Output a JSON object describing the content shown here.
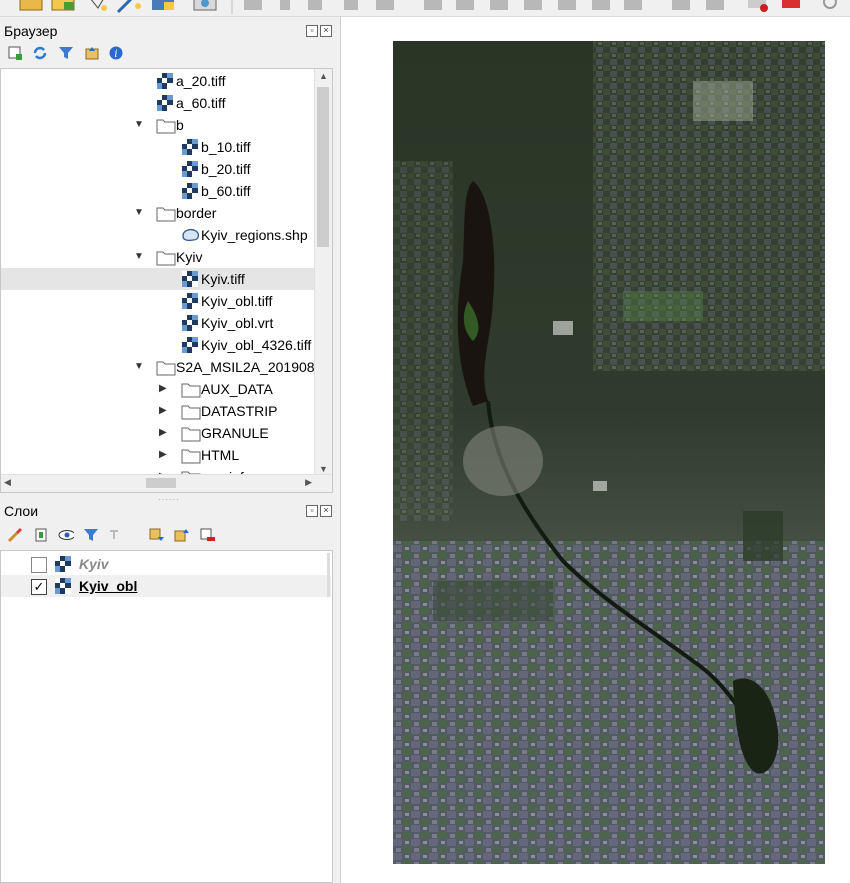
{
  "browser_panel": {
    "title": "Браузер",
    "tree": [
      {
        "label": "a_20.tiff",
        "icon": "raster-icon"
      },
      {
        "label": "a_60.tiff",
        "icon": "raster-icon"
      },
      {
        "label": "b",
        "icon": "folder-icon",
        "expanded": true
      },
      {
        "label": "b_10.tiff",
        "icon": "raster-icon"
      },
      {
        "label": "b_20.tiff",
        "icon": "raster-icon"
      },
      {
        "label": "b_60.tiff",
        "icon": "raster-icon"
      },
      {
        "label": "border",
        "icon": "folder-icon",
        "expanded": true
      },
      {
        "label": "Kyiv_regions.shp",
        "icon": "polygon-layer-icon"
      },
      {
        "label": "Kyiv",
        "icon": "folder-icon",
        "expanded": true
      },
      {
        "label": "Kyiv.tiff",
        "icon": "raster-icon",
        "selected": true
      },
      {
        "label": "Kyiv_obl.tiff",
        "icon": "raster-icon"
      },
      {
        "label": "Kyiv_obl.vrt",
        "icon": "raster-icon"
      },
      {
        "label": "Kyiv_obl_4326.tiff",
        "icon": "raster-icon"
      },
      {
        "label": "S2A_MSIL2A_201908",
        "icon": "folder-icon",
        "expanded": true
      },
      {
        "label": "AUX_DATA",
        "icon": "folder-icon",
        "expanded": false
      },
      {
        "label": "DATASTRIP",
        "icon": "folder-icon",
        "expanded": false
      },
      {
        "label": "GRANULE",
        "icon": "folder-icon",
        "expanded": false
      },
      {
        "label": "HTML",
        "icon": "folder-icon",
        "expanded": false
      },
      {
        "label": "rep_info",
        "icon": "folder-icon",
        "expanded": false
      }
    ]
  },
  "layers_panel": {
    "title": "Слои",
    "layers": [
      {
        "label": "Kyiv",
        "checked": false,
        "check_mark": ""
      },
      {
        "label": "Kyiv_obl",
        "checked": true,
        "check_mark": "✓"
      }
    ]
  },
  "colors": {
    "selection": "#e5e5e5",
    "raster_dark_green": "#1f2a1c",
    "raster_field_green": "#4a6a44",
    "raster_purple_fields": "#7a7890",
    "water": "#1a1410"
  }
}
